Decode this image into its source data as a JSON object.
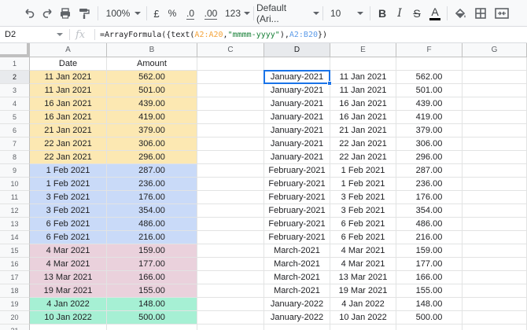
{
  "toolbar": {
    "zoom": "100%",
    "currency": "£",
    "percent": "%",
    "dec_less": ".0",
    "dec_more": ".00",
    "more_formats": "123",
    "font": "Default (Ari...",
    "font_size": "10",
    "bold": "B",
    "italic": "I",
    "strike": "S",
    "text_color": "A"
  },
  "formula_bar": {
    "name_box": "D2",
    "fx": "fx",
    "formula_prefix": "=ArrayFormula({text(",
    "formula_ref1": "A2:A20",
    "formula_comma1": ",",
    "formula_string": "\"mmmm-yyyy\"",
    "formula_mid": "),",
    "formula_ref2": "A2:B20",
    "formula_suffix": "})"
  },
  "columns": [
    "A",
    "B",
    "C",
    "D",
    "E",
    "F",
    "G"
  ],
  "row_numbers": [
    "1",
    "2",
    "3",
    "4",
    "5",
    "6",
    "7",
    "8",
    "9",
    "10",
    "11",
    "12",
    "13",
    "14",
    "15",
    "16",
    "17",
    "18",
    "19",
    "20",
    "21"
  ],
  "headers": {
    "a": "Date",
    "b": "Amount"
  },
  "colors": {
    "jan_2021": "#fce8b2",
    "feb_2021": "#c9daf8",
    "mar_2021": "#ead1dc",
    "jan_2022": "#a6f0d4",
    "selection": "#1a73e8"
  },
  "rows": [
    {
      "a": "11 Jan 2021",
      "b": "562.00",
      "d": "January-2021",
      "e": "11 Jan 2021",
      "f": "562.00",
      "group": "jan_2021"
    },
    {
      "a": "11 Jan 2021",
      "b": "501.00",
      "d": "January-2021",
      "e": "11 Jan 2021",
      "f": "501.00",
      "group": "jan_2021"
    },
    {
      "a": "16 Jan 2021",
      "b": "439.00",
      "d": "January-2021",
      "e": "16 Jan 2021",
      "f": "439.00",
      "group": "jan_2021"
    },
    {
      "a": "16 Jan 2021",
      "b": "419.00",
      "d": "January-2021",
      "e": "16 Jan 2021",
      "f": "419.00",
      "group": "jan_2021"
    },
    {
      "a": "21 Jan 2021",
      "b": "379.00",
      "d": "January-2021",
      "e": "21 Jan 2021",
      "f": "379.00",
      "group": "jan_2021"
    },
    {
      "a": "22 Jan 2021",
      "b": "306.00",
      "d": "January-2021",
      "e": "22 Jan 2021",
      "f": "306.00",
      "group": "jan_2021"
    },
    {
      "a": "22 Jan 2021",
      "b": "296.00",
      "d": "January-2021",
      "e": "22 Jan 2021",
      "f": "296.00",
      "group": "jan_2021"
    },
    {
      "a": "1 Feb 2021",
      "b": "287.00",
      "d": "February-2021",
      "e": "1 Feb 2021",
      "f": "287.00",
      "group": "feb_2021"
    },
    {
      "a": "1 Feb 2021",
      "b": "236.00",
      "d": "February-2021",
      "e": "1 Feb 2021",
      "f": "236.00",
      "group": "feb_2021"
    },
    {
      "a": "3 Feb 2021",
      "b": "176.00",
      "d": "February-2021",
      "e": "3 Feb 2021",
      "f": "176.00",
      "group": "feb_2021"
    },
    {
      "a": "3 Feb 2021",
      "b": "354.00",
      "d": "February-2021",
      "e": "3 Feb 2021",
      "f": "354.00",
      "group": "feb_2021"
    },
    {
      "a": "6 Feb 2021",
      "b": "486.00",
      "d": "February-2021",
      "e": "6 Feb 2021",
      "f": "486.00",
      "group": "feb_2021"
    },
    {
      "a": "6 Feb 2021",
      "b": "216.00",
      "d": "February-2021",
      "e": "6 Feb 2021",
      "f": "216.00",
      "group": "feb_2021"
    },
    {
      "a": "4 Mar 2021",
      "b": "159.00",
      "d": "March-2021",
      "e": "4 Mar 2021",
      "f": "159.00",
      "group": "mar_2021"
    },
    {
      "a": "4 Mar 2021",
      "b": "177.00",
      "d": "March-2021",
      "e": "4 Mar 2021",
      "f": "177.00",
      "group": "mar_2021"
    },
    {
      "a": "13 Mar 2021",
      "b": "166.00",
      "d": "March-2021",
      "e": "13 Mar 2021",
      "f": "166.00",
      "group": "mar_2021"
    },
    {
      "a": "19 Mar 2021",
      "b": "155.00",
      "d": "March-2021",
      "e": "19 Mar 2021",
      "f": "155.00",
      "group": "mar_2021"
    },
    {
      "a": "4 Jan 2022",
      "b": "148.00",
      "d": "January-2022",
      "e": "4 Jan 2022",
      "f": "148.00",
      "group": "jan_2022"
    },
    {
      "a": "10 Jan 2022",
      "b": "500.00",
      "d": "January-2022",
      "e": "10 Jan 2022",
      "f": "500.00",
      "group": "jan_2022"
    }
  ]
}
